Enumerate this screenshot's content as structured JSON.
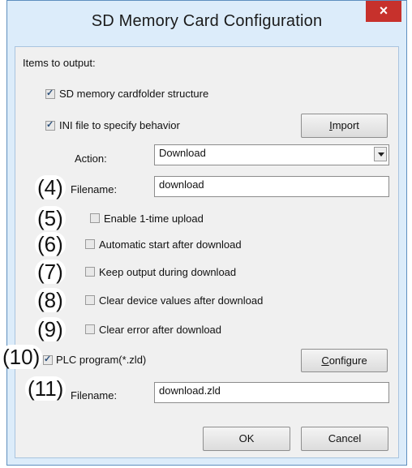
{
  "window": {
    "title": "SD Memory Card Configuration",
    "close_glyph": "×"
  },
  "section_label": "Items to output:",
  "options": {
    "sd_folder": {
      "label": "SD memory cardfolder structure",
      "checked": true
    },
    "ini_file": {
      "label": "INI file to specify behavior",
      "checked": true
    },
    "import_button": {
      "label_underlined": "I",
      "label_rest": "mport"
    }
  },
  "action": {
    "label": "Action:",
    "value": "Download"
  },
  "ini_filename": {
    "label": "Filename:",
    "value": "download"
  },
  "sub_options": [
    {
      "label": "Enable 1-time upload",
      "checked": false
    },
    {
      "label": "Automatic start after download",
      "checked": false
    },
    {
      "label": "Keep output during download",
      "checked": false
    },
    {
      "label": "Clear device values after download",
      "checked": false
    },
    {
      "label": "Clear error after download",
      "checked": false
    }
  ],
  "plc_program": {
    "label": "PLC program(*.zld)",
    "checked": true
  },
  "configure_button": {
    "label_underlined": "C",
    "label_rest": "onfigure"
  },
  "plc_filename": {
    "label": "Filename:",
    "value": "download.zld"
  },
  "buttons": {
    "ok": "OK",
    "cancel": "Cancel"
  },
  "callouts": [
    "(4)",
    "(5)",
    "(6)",
    "(7)",
    "(8)",
    "(9)",
    "(10)",
    "(11)"
  ]
}
